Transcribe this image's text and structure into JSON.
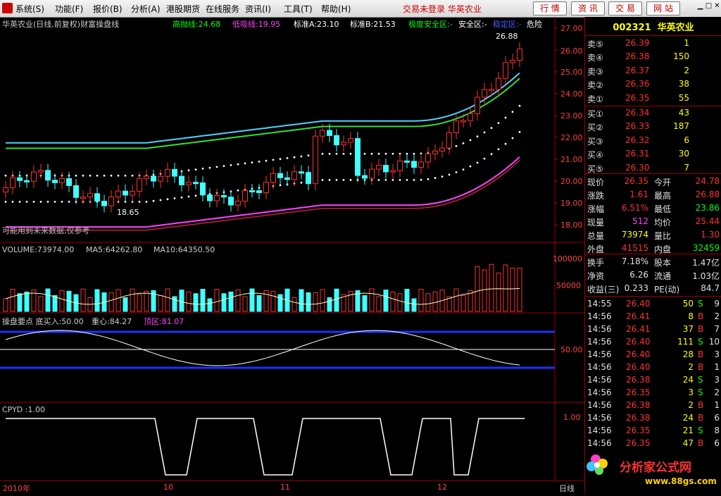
{
  "menu": {
    "items": [
      "系统(S)",
      "功能(F)",
      "报价(B)",
      "分析(A)",
      "港股期货",
      "在线服务",
      "资讯(I)",
      "工具(T)",
      "帮助(H)"
    ],
    "status": "交易未登录  华英农业",
    "buttons": [
      "行 情",
      "资 讯",
      "交 易",
      "网 站"
    ]
  },
  "chart": {
    "title": "华英农业(日线,前复权)财富操盘线",
    "indicators": [
      {
        "label": "高抛线:24.68",
        "color": "#00ff00"
      },
      {
        "label": "低吸线:19.95",
        "color": "#ff40ff"
      },
      {
        "label": "标准A:23.10",
        "color": "#ffffff"
      },
      {
        "label": "标准B:21.53",
        "color": "#ffffff"
      },
      {
        "label": "极度安全区:-",
        "color": "#00ff00"
      },
      {
        "label": "安全区:-",
        "color": "#ffffff"
      },
      {
        "label": "稳定区:-",
        "color": "#4060ff"
      },
      {
        "label": "危险",
        "color": "#ffffff"
      }
    ],
    "price_axis": [
      "27.00",
      "26.00",
      "25.00",
      "24.00",
      "23.00",
      "22.00",
      "21.00",
      "20.00",
      "19.00",
      "18.00"
    ],
    "high_marker": "26.88",
    "low_marker": "18.65",
    "note": "可能用到未来数据,仅参考",
    "volume": {
      "labels": [
        "VOLUME:73974.00",
        "MA5:64262.80",
        "MA10:64350.50"
      ],
      "axis": [
        "100000",
        "50000"
      ]
    },
    "panel3": {
      "labels": [
        "操盘要点  底买入:50.00",
        "重心:84.27",
        "顶区:81.07"
      ],
      "axis": [
        "50.00"
      ]
    },
    "panel4": {
      "label": "CPYD :1.00",
      "axis": [
        "1.00"
      ]
    },
    "time_axis": [
      "2010年",
      "10",
      "11",
      "12"
    ],
    "period": "日线"
  },
  "quote": {
    "code": "002321",
    "name": "华英农业",
    "asks": [
      {
        "label": "卖⑤",
        "price": "26.39",
        "vol": "1"
      },
      {
        "label": "卖④",
        "price": "26.38",
        "vol": "150"
      },
      {
        "label": "卖③",
        "price": "26.37",
        "vol": "2"
      },
      {
        "label": "卖②",
        "price": "26.36",
        "vol": "38"
      },
      {
        "label": "卖①",
        "price": "26.35",
        "vol": "55"
      }
    ],
    "bids": [
      {
        "label": "买①",
        "price": "26.34",
        "vol": "43"
      },
      {
        "label": "买②",
        "price": "26.33",
        "vol": "187"
      },
      {
        "label": "买③",
        "price": "26.32",
        "vol": "6"
      },
      {
        "label": "买④",
        "price": "26.31",
        "vol": "30"
      },
      {
        "label": "买⑤",
        "price": "26.30",
        "vol": "7"
      }
    ],
    "stats": [
      {
        "l1": "现价",
        "v1": "26.35",
        "c1": "#ff3030",
        "l2": "今开",
        "v2": "24.78",
        "c2": "#ff3030"
      },
      {
        "l1": "涨跌",
        "v1": "1.61",
        "c1": "#ff3030",
        "l2": "最高",
        "v2": "26.88",
        "c2": "#ff3030"
      },
      {
        "l1": "涨幅",
        "v1": "6.51%",
        "c1": "#ff3030",
        "l2": "最低",
        "v2": "23.86",
        "c2": "#00ff00"
      },
      {
        "l1": "现量",
        "v1": "512",
        "c1": "#ff40ff",
        "l2": "均价",
        "v2": "25.44",
        "c2": "#ff3030"
      },
      {
        "l1": "总量",
        "v1": "73974",
        "c1": "#ffff00",
        "l2": "量比",
        "v2": "1.30",
        "c2": "#ff3030"
      },
      {
        "l1": "外盘",
        "v1": "41515",
        "c1": "#ff3030",
        "l2": "内盘",
        "v2": "32459",
        "c2": "#00ff00"
      }
    ],
    "stats2": [
      {
        "l1": "换手",
        "v1": "7.18%",
        "l2": "股本",
        "v2": "1.47亿"
      },
      {
        "l1": "净资",
        "v1": "6.26",
        "l2": "流通",
        "v2": "1.03亿"
      },
      {
        "l1": "收益(三)",
        "v1": "0.233",
        "l2": "PE(动)",
        "v2": "84.7"
      }
    ],
    "ticks": [
      {
        "time": "14:55",
        "price": "26.40",
        "vol": "50",
        "bs": "S",
        "n": "9"
      },
      {
        "time": "14:56",
        "price": "26.41",
        "vol": "8",
        "bs": "B",
        "n": "2"
      },
      {
        "time": "14:56",
        "price": "26.41",
        "vol": "37",
        "bs": "B",
        "n": "7"
      },
      {
        "time": "14:56",
        "price": "26.40",
        "vol": "111",
        "bs": "S",
        "n": "10"
      },
      {
        "time": "14:56",
        "price": "26.40",
        "vol": "28",
        "bs": "B",
        "n": "3"
      },
      {
        "time": "14:56",
        "price": "26.40",
        "vol": "2",
        "bs": "B",
        "n": "1"
      },
      {
        "time": "14:56",
        "price": "26.38",
        "vol": "24",
        "bs": "S",
        "n": "3"
      },
      {
        "time": "14:56",
        "price": "26.35",
        "vol": "3",
        "bs": "S",
        "n": "2"
      },
      {
        "time": "14:56",
        "price": "26.38",
        "vol": "2",
        "bs": "B",
        "n": "1"
      },
      {
        "time": "14:56",
        "price": "26.38",
        "vol": "24",
        "bs": "B",
        "n": "6"
      },
      {
        "time": "14:56",
        "price": "26.35",
        "vol": "21",
        "bs": "S",
        "n": "8"
      },
      {
        "time": "14:56",
        "price": "26.35",
        "vol": "47",
        "bs": "B",
        "n": "6"
      }
    ]
  },
  "watermark": {
    "site": "分析家公式网",
    "url": "www.88gs.com"
  }
}
